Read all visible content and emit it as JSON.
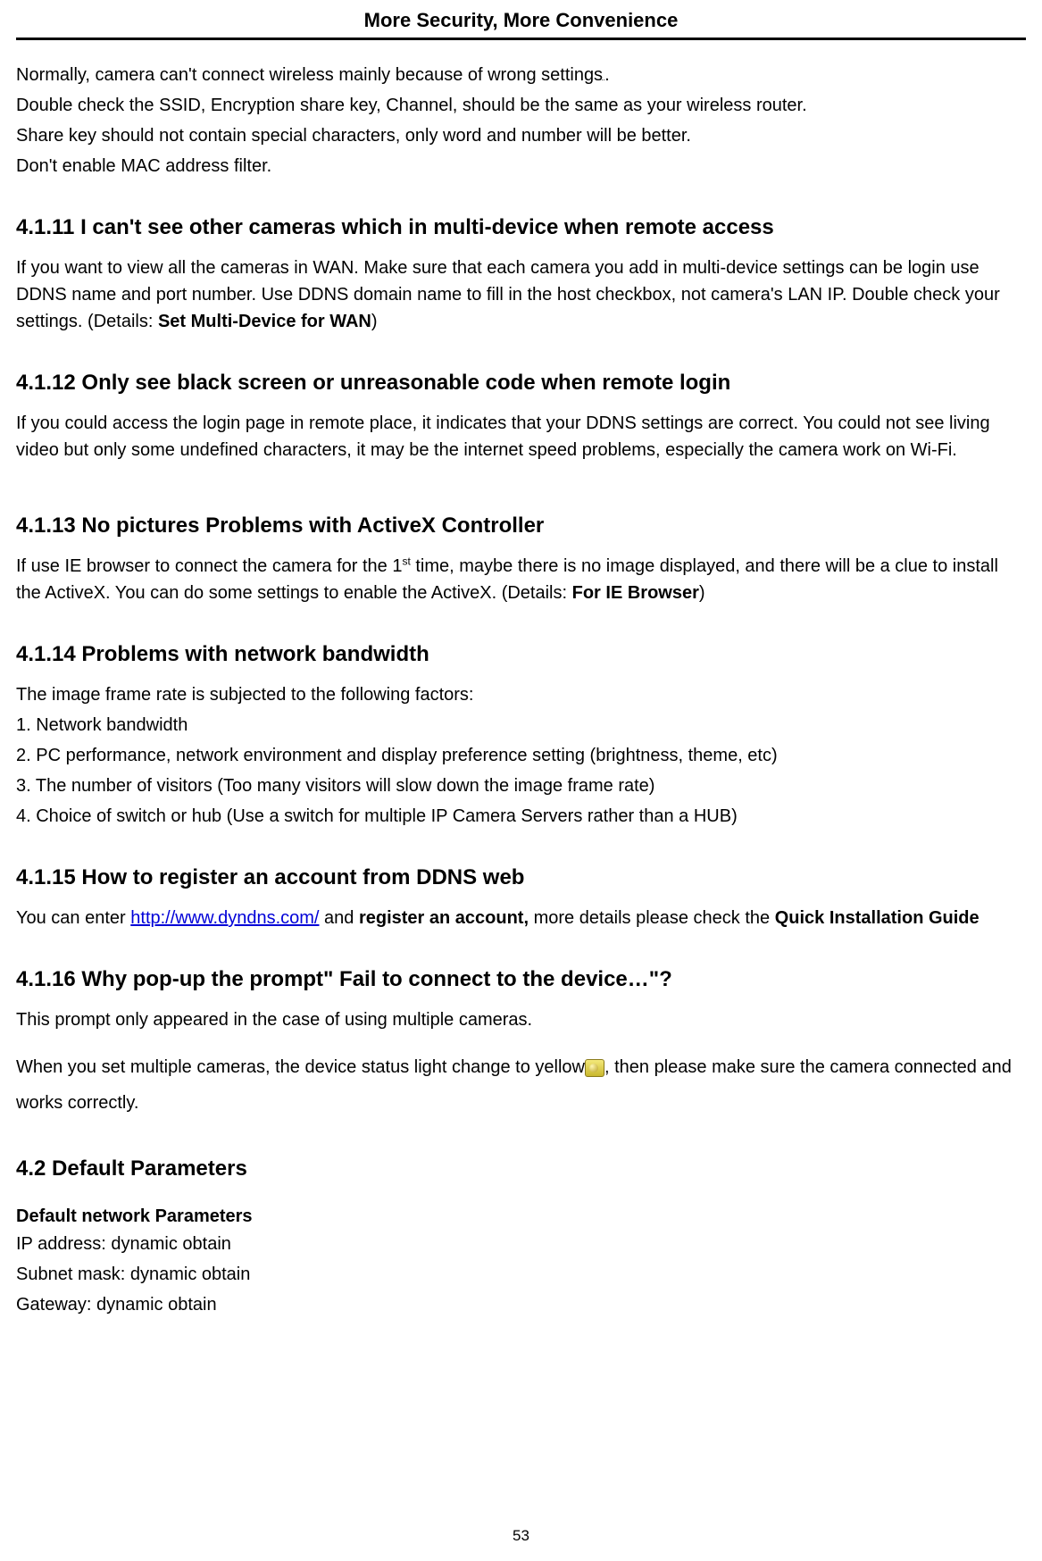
{
  "header": "More Security, More Convenience",
  "intro": {
    "l1a": "Normally, camera can't connect wireless mainly because of wrong settings",
    "l1b": ".",
    "l2": "Double check the SSID, Encryption share key, Channel, should be the same as your wireless router.",
    "l3": "Share key should not contain special characters, only word and number will be better.",
    "l4": "Don't enable MAC address filter."
  },
  "s11": {
    "heading": "4.1.11 I can't see other cameras which in multi-device when remote access",
    "p1a": "If you want to view all the cameras in WAN. Make sure that each camera you add in multi-device settings can be login use DDNS name and port number. Use DDNS domain name to fill in the host checkbox, not camera's LAN IP. Double check your settings. (Details: ",
    "p1b": "Set Multi-Device for WAN",
    "p1c": ")"
  },
  "s12": {
    "heading": "4.1.12 Only see black screen or unreasonable code when remote login",
    "p1": "If you could access the login page in remote place, it indicates that your DDNS settings are correct. You could not see living video but only some undefined characters, it may be the internet speed problems, especially the camera work on Wi-Fi."
  },
  "s13": {
    "heading": "4.1.13 No pictures Problems with ActiveX Controller",
    "p1a": "If use IE browser to connect the camera for the 1",
    "p1sup": "st",
    "p1b": " time, maybe there is no image displayed, and there will be a clue to install the ActiveX. You can do some settings to enable the ActiveX. (Details: ",
    "p1c": "For IE Browser",
    "p1d": ")"
  },
  "s14": {
    "heading": "4.1.14 Problems with network bandwidth",
    "p1": "The image frame rate is subjected to the following factors:",
    "l1": "1. Network bandwidth",
    "l2": "2. PC performance, network environment and display preference setting (brightness, theme, etc)",
    "l3": "3. The number of visitors (Too many visitors will slow down the image frame rate)",
    "l4": "4. Choice of switch or hub (Use a switch for multiple IP Camera Servers rather than a HUB)"
  },
  "s15": {
    "heading": "4.1.15 How to register an account from DDNS web",
    "p1a": "You can enter ",
    "link": "http://www.dyndns.com/",
    "p1b": " and ",
    "p1c": "register an account,",
    "p1d": " more details please check the ",
    "p1e": "Quick Installation Guide"
  },
  "s16": {
    "heading": "4.1.16 Why pop-up the prompt\" Fail to connect to the device…\"?",
    "p1": "This prompt only appeared in the case of using multiple cameras.",
    "p2a": "When you set multiple cameras, the device status light change to yellow",
    "p2b": ", then please make sure the camera connected and works correctly."
  },
  "s42": {
    "heading": "4.2 Default Parameters",
    "sub": "Default network Parameters",
    "l1": "IP address: dynamic obtain",
    "l2": "Subnet mask: dynamic obtain",
    "l3": "Gateway: dynamic obtain"
  },
  "pagenum": "53"
}
